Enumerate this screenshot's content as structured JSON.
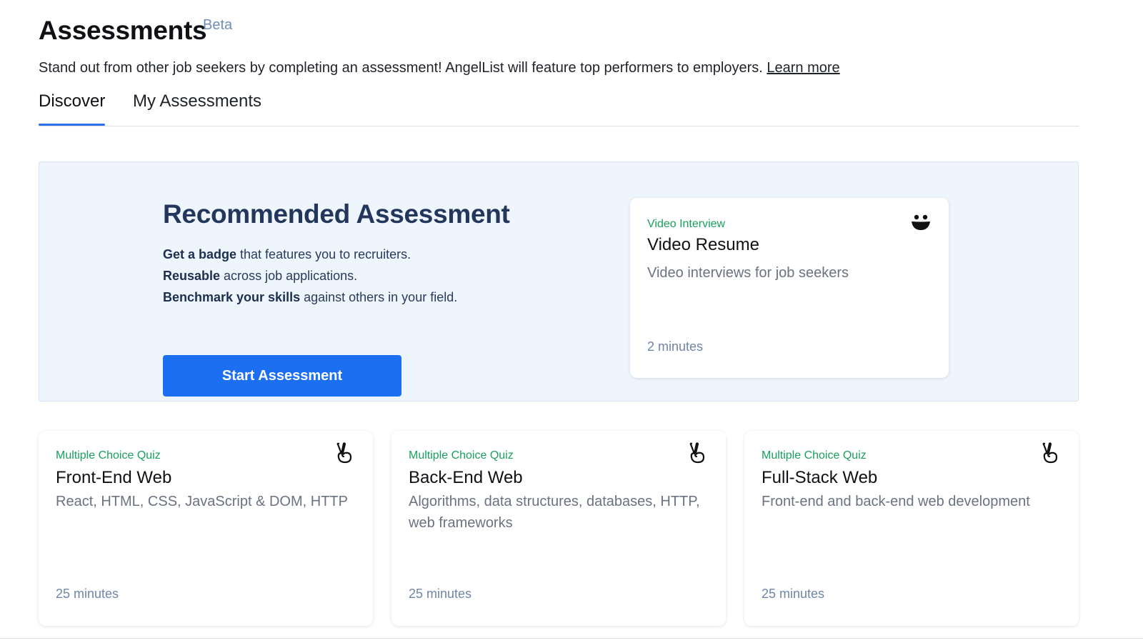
{
  "header": {
    "title": "Assessments",
    "badge": "Beta",
    "subtitle": "Stand out from other job seekers by completing an assessment! AngelList will feature top performers to employers.",
    "learn_more": "Learn more"
  },
  "tabs": [
    {
      "label": "Discover",
      "active": true
    },
    {
      "label": "My Assessments",
      "active": false
    }
  ],
  "hero": {
    "heading": "Recommended Assessment",
    "lines": [
      {
        "bold": "Get a badge",
        "rest": " that features you to recruiters."
      },
      {
        "bold": "Reusable",
        "rest": " across job applications."
      },
      {
        "bold": "Benchmark your skills",
        "rest": " against others in your field."
      }
    ],
    "button": "Start Assessment",
    "card": {
      "type": "Video Interview",
      "title": "Video Resume",
      "description": "Video interviews for job seekers",
      "duration": "2 minutes",
      "icon": "smiley-icon"
    }
  },
  "cards": [
    {
      "type": "Multiple Choice Quiz",
      "title": "Front-End Web",
      "description": "React, HTML, CSS, JavaScript & DOM, HTTP",
      "duration": "25 minutes",
      "icon": "peace-hand-icon"
    },
    {
      "type": "Multiple Choice Quiz",
      "title": "Back-End Web",
      "description": "Algorithms, data structures, databases, HTTP, web frameworks",
      "duration": "25 minutes",
      "icon": "peace-hand-icon"
    },
    {
      "type": "Multiple Choice Quiz",
      "title": "Full-Stack Web",
      "description": "Front-end and back-end web development",
      "duration": "25 minutes",
      "icon": "peace-hand-icon"
    }
  ],
  "colors": {
    "accent_blue": "#1d6ff2",
    "tab_underline": "#2c6fe6",
    "type_green": "#18a05c",
    "hero_bg": "#eef5fd",
    "hero_heading": "#23375c"
  }
}
